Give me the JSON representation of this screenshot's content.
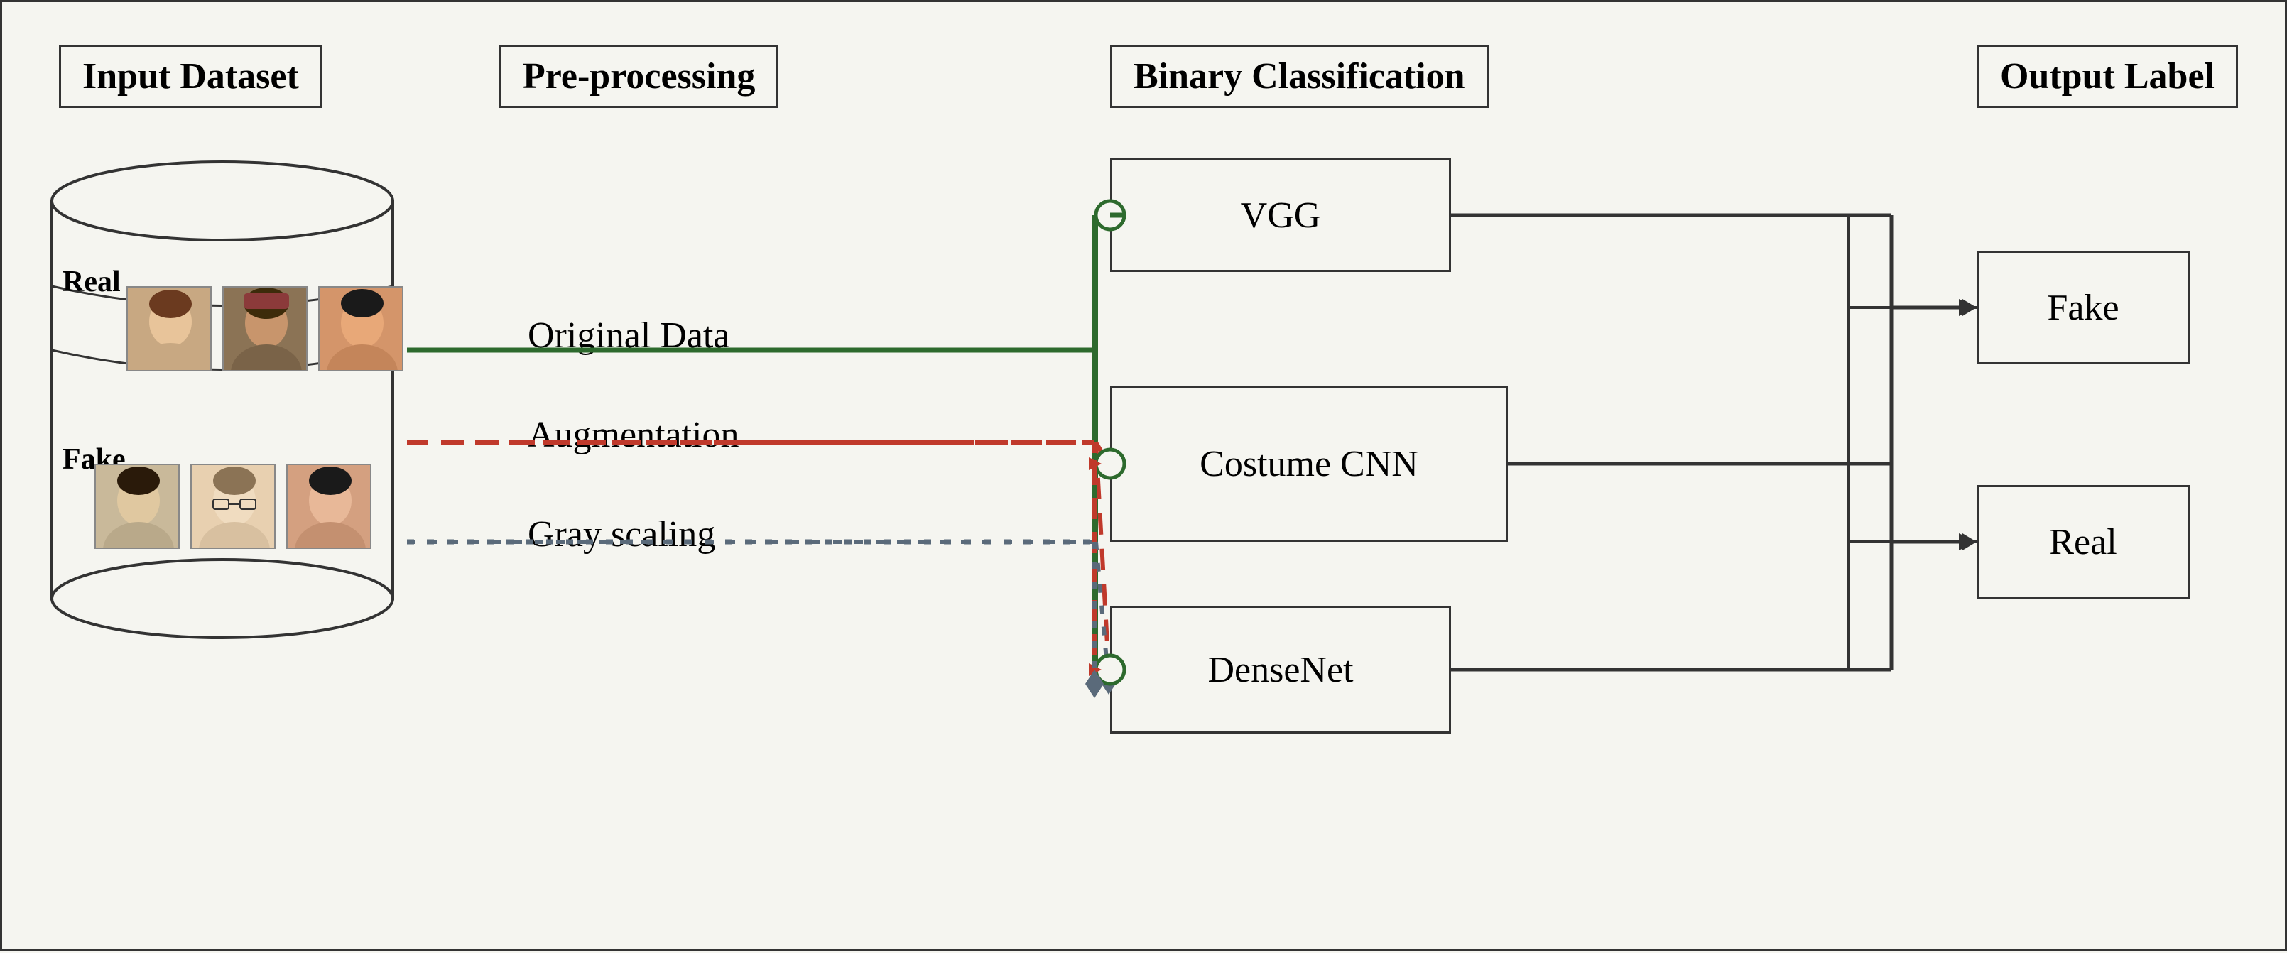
{
  "headers": {
    "input_dataset": "Input Dataset",
    "preprocessing": "Pre-processing",
    "binary_classification": "Binary Classification",
    "output_label": "Output Label"
  },
  "models": {
    "vgg": "VGG",
    "costume_cnn": "Costume CNN",
    "densenet": "DenseNet"
  },
  "outputs": {
    "fake": "Fake",
    "real": "Real"
  },
  "labels": {
    "original_data": "Original Data",
    "augmentation": "Augmentation",
    "gray_scaling": "Gray scaling",
    "real": "Real",
    "fake": "Fake"
  },
  "colors": {
    "green": "#2d6a2d",
    "red_dashed": "#c0392b",
    "blue_dotted": "#5a6a7a",
    "arrow": "#333"
  }
}
